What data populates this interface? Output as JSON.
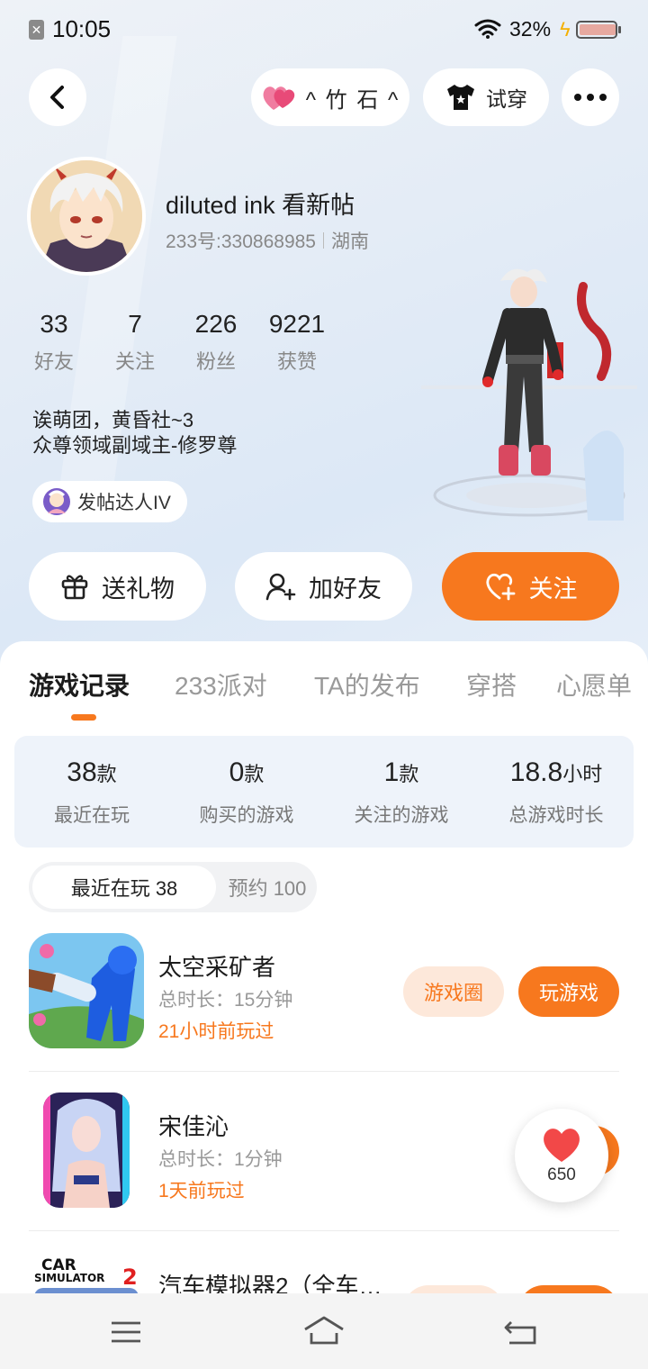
{
  "status": {
    "time": "10:05",
    "battery": "32%"
  },
  "header": {
    "nickname_pill": "^ 竹 石 ^",
    "tryon_label": "试穿"
  },
  "profile": {
    "name": "diluted ink 看新帖",
    "id": "233号:330868985",
    "region": "湖南",
    "bio_line1": "诶萌团，黄昏社~3",
    "bio_line2": "众尊领域副域主-修罗尊",
    "badge": "发帖达人IV"
  },
  "stats": [
    {
      "num": "33",
      "label": "好友"
    },
    {
      "num": "7",
      "label": "关注"
    },
    {
      "num": "226",
      "label": "粉丝"
    },
    {
      "num": "9221",
      "label": "获赞"
    }
  ],
  "actions": {
    "gift": "送礼物",
    "add_friend": "加好友",
    "follow": "关注"
  },
  "tabs": [
    "游戏记录",
    "233派对",
    "TA的发布",
    "穿搭",
    "心愿单"
  ],
  "summary": [
    {
      "value": "38",
      "unit": "款",
      "label": "最近在玩"
    },
    {
      "value": "0",
      "unit": "款",
      "label": "购买的游戏"
    },
    {
      "value": "1",
      "unit": "款",
      "label": "关注的游戏"
    },
    {
      "value": "18.8",
      "unit": "小时",
      "label": "总游戏时长"
    }
  ],
  "subtabs": {
    "recent": "最近在玩 38",
    "reserve": "预约 100"
  },
  "games": [
    {
      "title": "太空采矿者",
      "time": "总时长：15分钟",
      "last": "21小时前玩过",
      "circle_btn": "游戏圈",
      "play_btn": "玩游戏"
    },
    {
      "title": "宋佳沁",
      "time": "总时长：1分钟",
      "last": "1天前玩过"
    },
    {
      "title": "汽车模拟器2（全车…"
    }
  ],
  "like_count": "650",
  "colors": {
    "accent": "#f7781e",
    "accent_light": "#fde8da"
  }
}
